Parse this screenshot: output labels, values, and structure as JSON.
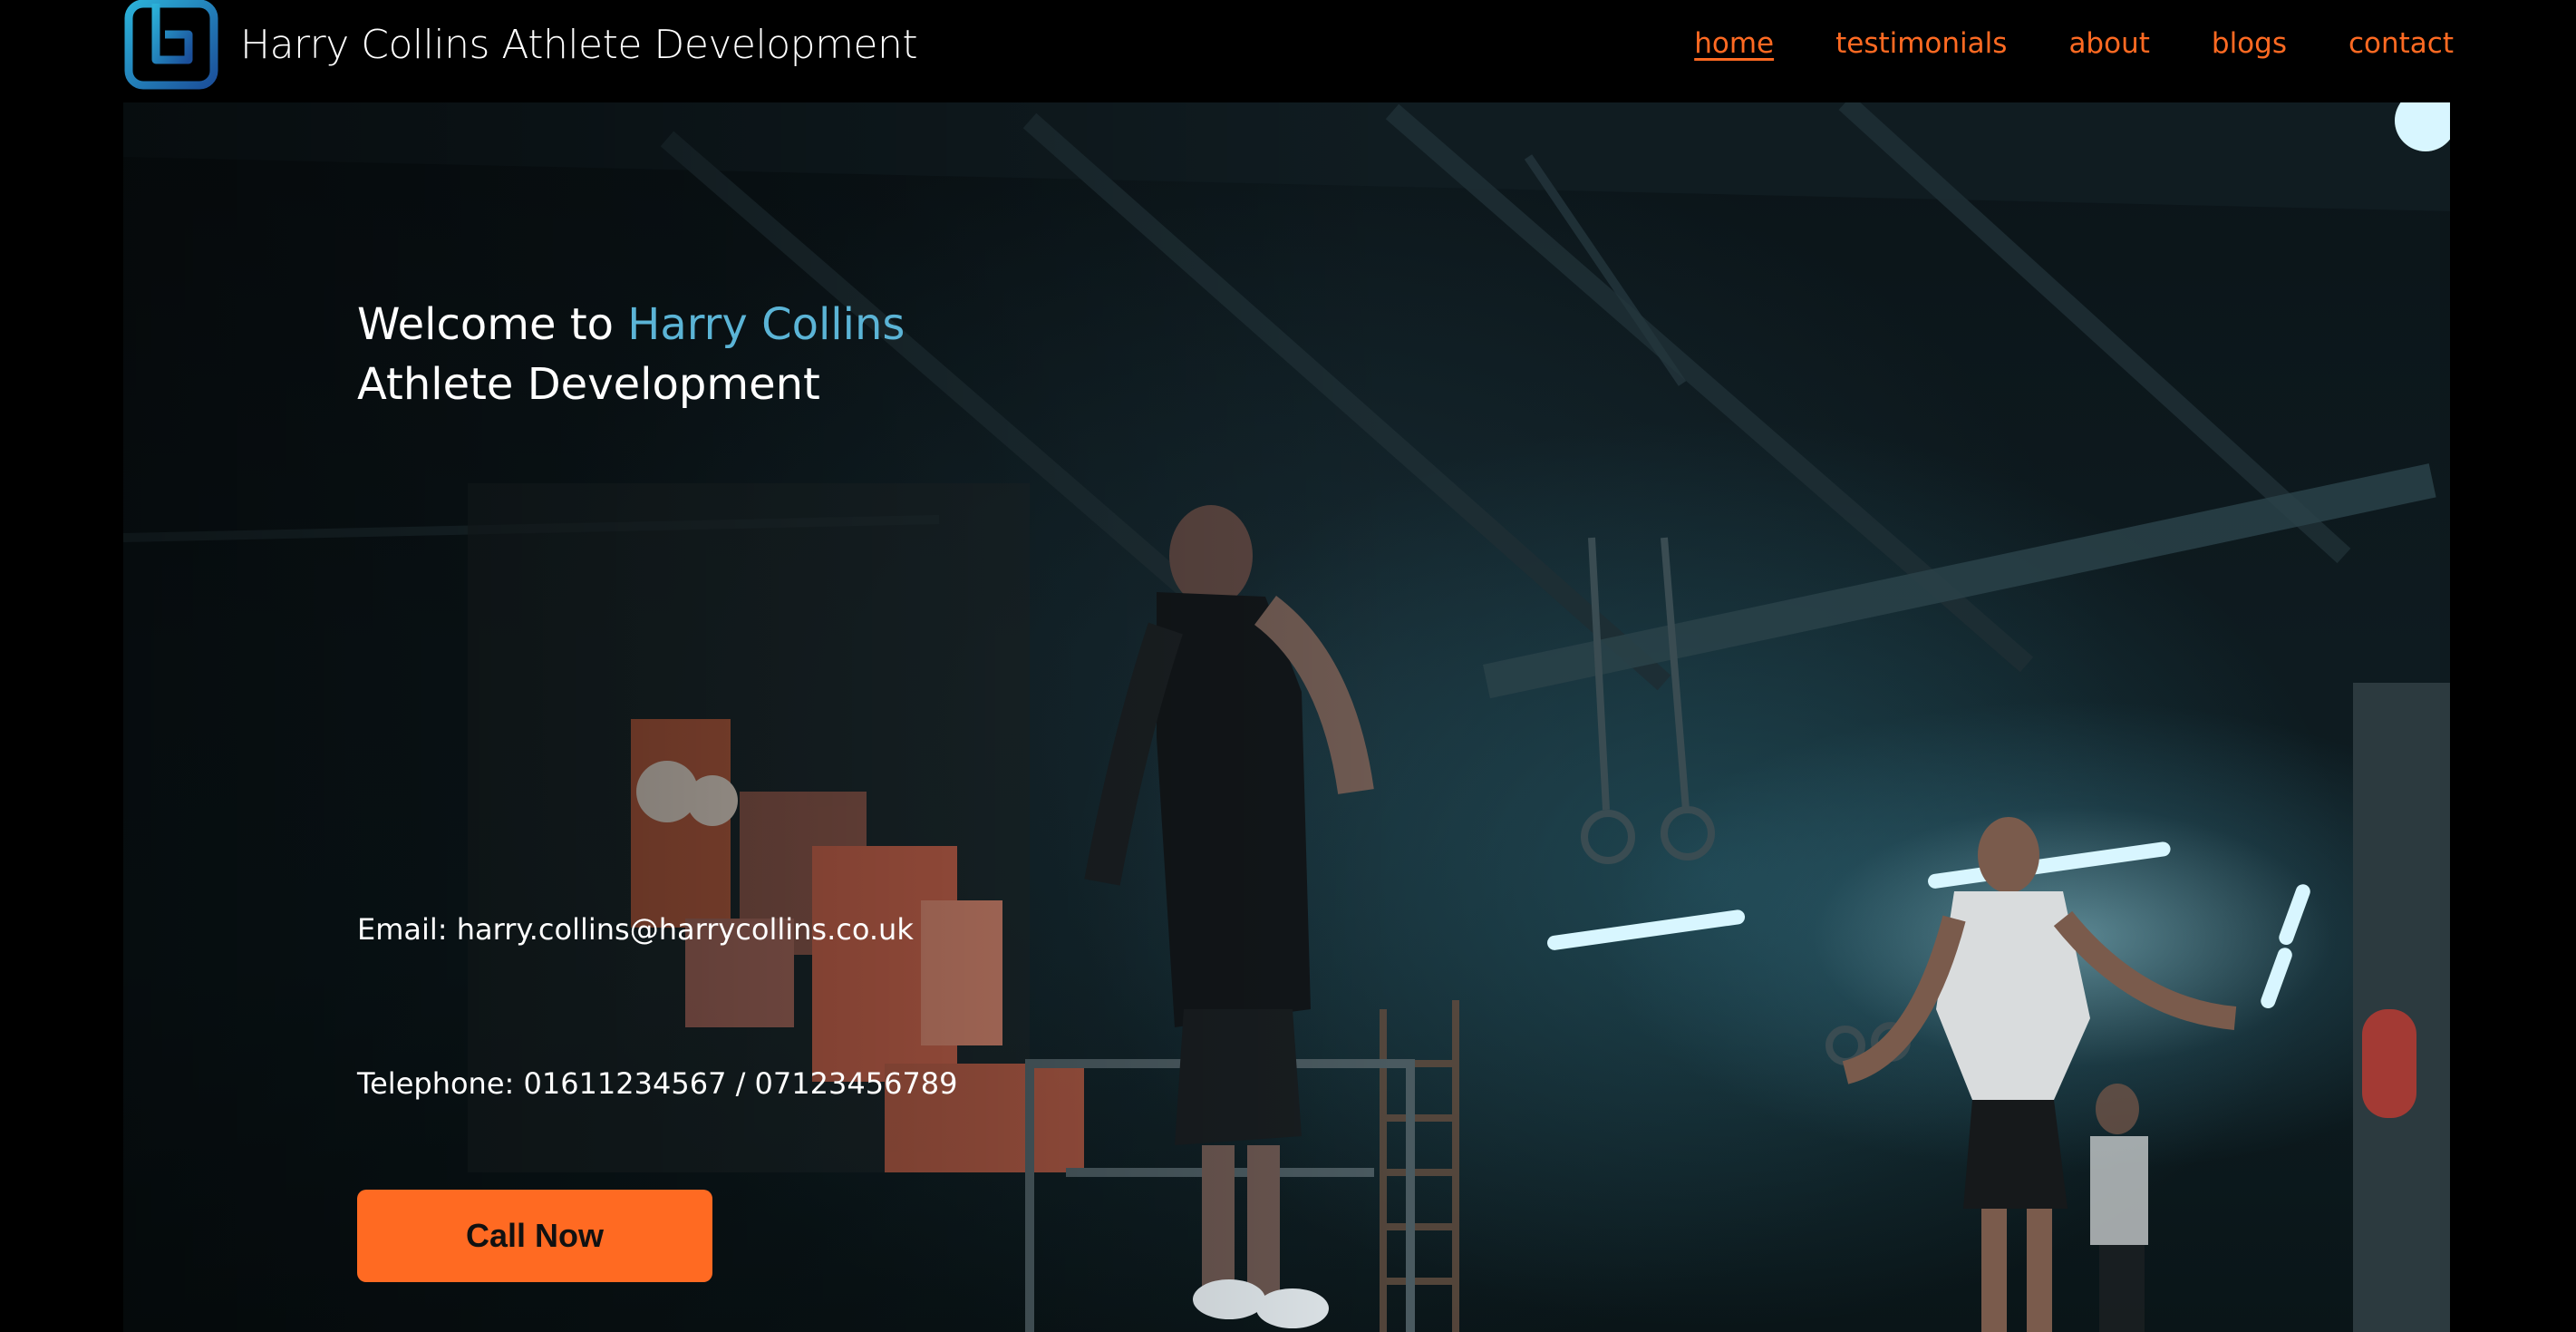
{
  "header": {
    "brand": "Harry Collins Athlete Development",
    "logo_icon": "square-logo-icon"
  },
  "nav": {
    "items": [
      {
        "label": "home",
        "active": true
      },
      {
        "label": "testimonials",
        "active": false
      },
      {
        "label": "about",
        "active": false
      },
      {
        "label": "blogs",
        "active": false
      },
      {
        "label": "contact",
        "active": false
      }
    ]
  },
  "hero": {
    "title_prefix": "Welcome to ",
    "title_accent": "Harry Collins",
    "title_suffix": "Athlete Development",
    "email": "Email: harry.collins@harrycollins.co.uk",
    "telephone": "Telephone: 01611234567 / 07123456789",
    "cta_label": "Call Now"
  },
  "colors": {
    "accent_orange": "#ff6a22",
    "accent_blue": "#5bb4d6",
    "background": "#000000"
  }
}
